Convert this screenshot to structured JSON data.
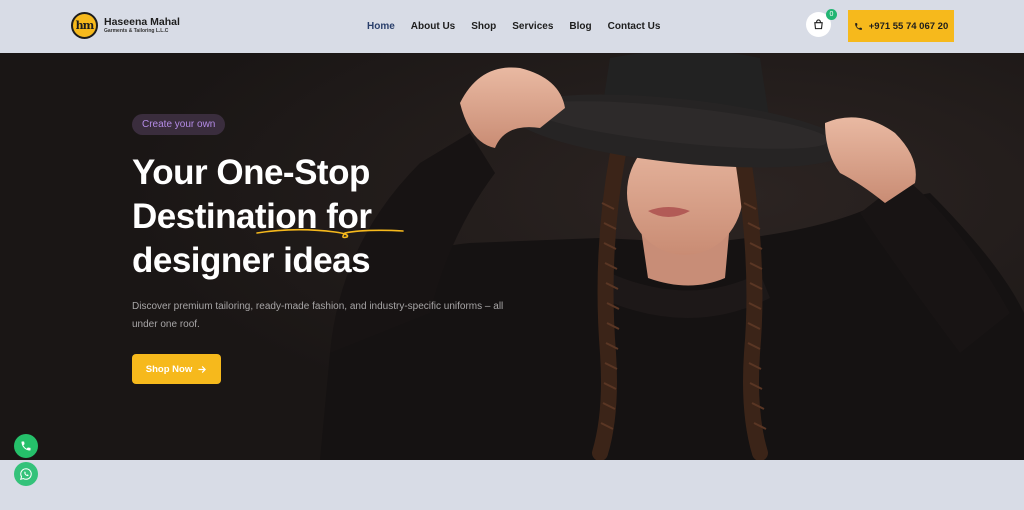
{
  "brand": {
    "mark": "hm",
    "name": "Haseena Mahal",
    "subtitle": "Garments & Tailoring L.L.C"
  },
  "nav": {
    "items": [
      {
        "label": "Home",
        "active": true
      },
      {
        "label": "About Us",
        "active": false
      },
      {
        "label": "Shop",
        "active": false
      },
      {
        "label": "Services",
        "active": false
      },
      {
        "label": "Blog",
        "active": false
      },
      {
        "label": "Contact Us",
        "active": false
      }
    ]
  },
  "cart": {
    "icon": "shopping-bag-icon",
    "count": "0"
  },
  "contact": {
    "phone": "+971 55 74 067 20",
    "icon": "phone-icon"
  },
  "hero": {
    "tag": "Create your own",
    "headline": [
      "Your One-Stop",
      "Destination for",
      "designer ideas"
    ],
    "description": "Discover premium tailoring, ready-made fashion, and industry-specific uniforms – all under one roof.",
    "cta": "Shop Now"
  },
  "floating": {
    "call_icon": "phone-icon",
    "whatsapp_icon": "whatsapp-icon"
  },
  "colors": {
    "accent": "#f6b91c",
    "hero_bg": "#1f1a19",
    "tag_text": "#b48be6",
    "nav_active": "#2a3f6b",
    "header_bg": "#d8dce6"
  }
}
